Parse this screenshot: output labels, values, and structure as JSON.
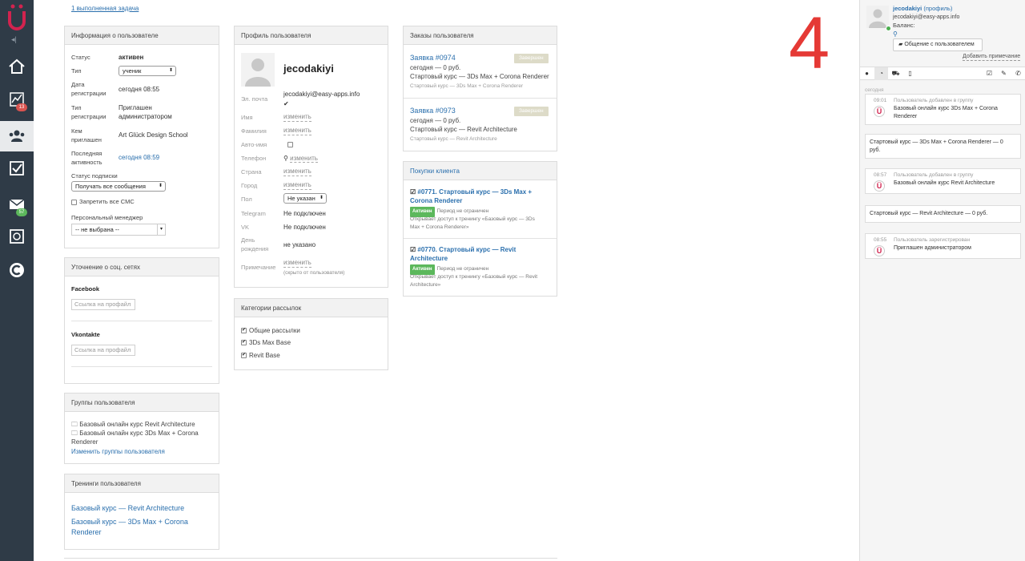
{
  "top_link": "1 выполненная задача",
  "big_number": "4",
  "sidebar": {
    "badge_stats": "13",
    "badge_mail": "57"
  },
  "user_info": {
    "title": "Информация о пользователе",
    "status_label": "Статус",
    "status_value": "активен",
    "type_label": "Тип",
    "type_value": "ученик",
    "reg_date_label": "Дата регистрации",
    "reg_date_value": "сегодня 08:55",
    "reg_type_label": "Тип регистрации",
    "reg_type_value": "Приглашен администратором",
    "invited_by_label": "Кем приглашен",
    "invited_by_value": "Art Glück Design School",
    "last_active_label": "Последняя активность",
    "last_active_value": "сегодня 08:59",
    "subscription_label": "Статус подписки",
    "subscription_value": "Получать все сообщения",
    "no_sms_label": "Запретить все СМС",
    "manager_label": "Персональный менеджер",
    "manager_value": "-- не выбрана --"
  },
  "social": {
    "title": "Уточнение о соц. сетях",
    "facebook_label": "Facebook",
    "facebook_placeholder": "Ссылка на профайл",
    "vk_label": "Vkontakte",
    "vk_placeholder": "Ссылка на профайл"
  },
  "groups": {
    "title": "Группы пользователя",
    "items": [
      "Базовый онлайн курс Revit Architecture",
      "Базовый онлайн курс 3Ds Max + Corona Renderer"
    ],
    "change_link": "Изменить группы пользователя"
  },
  "trainings": {
    "title": "Тренинги пользователя",
    "items": [
      "Базовый курс — Revit Architecture",
      "Базовый курс — 3Ds Max + Corona Renderer"
    ]
  },
  "profile": {
    "title": "Профиль пользователя",
    "username": "jecodakiyi",
    "email_label": "Эл. почта",
    "email_value": "jecodakiyi@easy-apps.info",
    "name_label": "Имя",
    "surname_label": "Фамилия",
    "auto_name_label": "Авто-имя",
    "phone_label": "Телефон",
    "country_label": "Страна",
    "city_label": "Город",
    "gender_label": "Пол",
    "gender_value": "Не указан",
    "telegram_label": "Telegram",
    "telegram_value": "Не подключен",
    "vk_label": "VK",
    "vk_value": "Не подключен",
    "birthday_label": "День рождения",
    "birthday_value": "не указано",
    "note_label": "Примечание",
    "note_hidden": "(скрыто от пользователя)",
    "edit": "изменить"
  },
  "mailing": {
    "title": "Категории рассылок",
    "items": [
      "Общие рассылки",
      "3Ds Max Base",
      "Revit Base"
    ]
  },
  "orders": {
    "title": "Заказы пользователя",
    "items": [
      {
        "link": "Заявка #0974",
        "date": "сегодня — 0 руб.",
        "name": "Стартовый курс — 3Ds Max + Corona Renderer",
        "sub": "Стартовый курс — 3Ds Max + Corona Renderer",
        "status": "Завершен"
      },
      {
        "link": "Заявка #0973",
        "date": "сегодня — 0 руб.",
        "name": "Стартовый курс — Revit Architecture",
        "sub": "Стартовый курс — Revit Architecture",
        "status": "Завершен"
      }
    ]
  },
  "purchases": {
    "title": "Покупки клиента",
    "items": [
      {
        "line1": "#0771. Стартовый курс — 3Ds Max +",
        "line2": "Corona Renderer",
        "badge": "Активен",
        "period": "Период не ограничен",
        "desc1": "Открывает доступ к тренингу «Базовый курс — 3Ds",
        "desc2": "Max + Corona Renderer»"
      },
      {
        "line1": "#0770. Стартовый курс — Revit",
        "line2": "Architecture",
        "badge": "Активен",
        "period": "Период не ограничен",
        "desc1": "Открывает доступ к тренингу «Базовый курс — Revit",
        "desc2": "Architecture»"
      }
    ]
  },
  "right": {
    "username": "jecodakiyi",
    "profile_link": "(профиль)",
    "email": "jecodakiyi@easy-apps.info",
    "balance": "Баланс:",
    "chat_button": "Общение с пользователем",
    "add_note": "Добавить примечание",
    "today": "сегодня",
    "events": [
      {
        "time": "09:01",
        "head": "Пользователь добавлен в группу",
        "body1": "Базовый онлайн курс 3Ds Max + Corona",
        "body2": "Renderer"
      },
      {
        "text1": "Стартовый курс — 3Ds Max + Corona Renderer — 0",
        "text2": "руб."
      },
      {
        "time": "08:57",
        "head": "Пользователь добавлен в группу",
        "body1": "Базовый онлайн курс Revit Architecture",
        "body2": ""
      },
      {
        "text1": "Стартовый курс — Revit Architecture — 0 руб.",
        "text2": ""
      },
      {
        "time": "08:55",
        "head": "Пользователь зарегистрирован",
        "body1": "Приглашен администратором",
        "body2": ""
      }
    ]
  }
}
